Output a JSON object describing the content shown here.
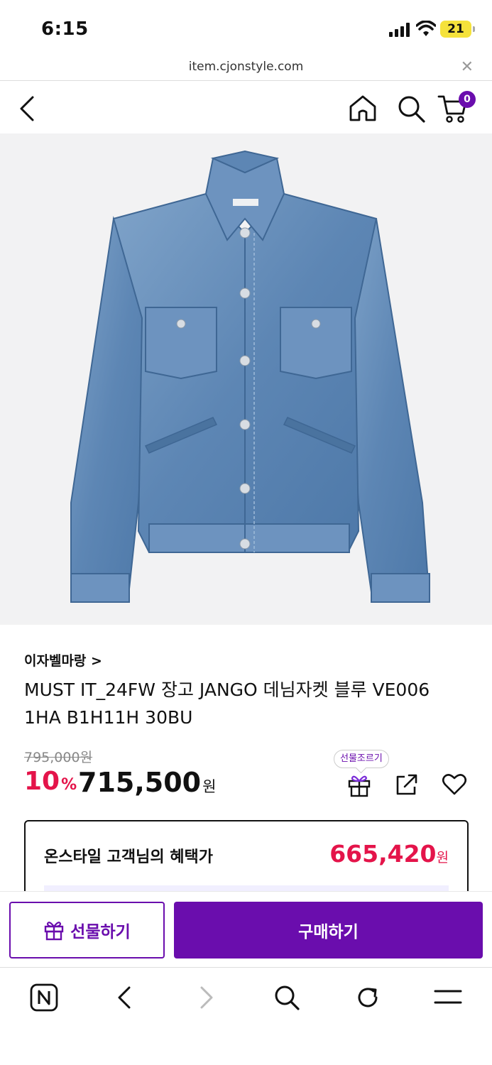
{
  "status_bar": {
    "time": "6:15",
    "battery": "21",
    "icons": [
      "signal-icon",
      "wifi-icon",
      "battery-icon"
    ]
  },
  "browser": {
    "url": "item.cjonstyle.com",
    "close_icon": "close-icon",
    "toolbar_icons": [
      "naver-icon",
      "back-icon",
      "forward-icon",
      "search-icon",
      "refresh-icon",
      "menu-icon"
    ]
  },
  "header": {
    "icons": [
      "back-icon",
      "home-icon",
      "search-icon",
      "cart-icon"
    ],
    "cart_count": "0"
  },
  "product": {
    "image": "denim-jacket-photo",
    "brand": "이자벨마랑 >",
    "title": "MUST IT_24FW 장고 JANGO 데님자켓 블루 VE006 1HA B1H11H 30BU",
    "original_price": "795,000원",
    "discount": "10",
    "discount_unit": "%",
    "price": "715,500",
    "price_unit": "원",
    "gift_tooltip": "선물조르기",
    "action_icons": [
      "gift-icon",
      "share-icon",
      "heart-icon"
    ]
  },
  "benefit": {
    "label": "온스타일 고객님의 혜택가",
    "price": "665,420",
    "unit": "원"
  },
  "buy_bar": {
    "gift_label": "선물하기",
    "buy_label": "구매하기"
  },
  "colors": {
    "brand_purple": "#6a0dad",
    "sale_red": "#e4144a",
    "battery_yellow": "#f5e23b"
  }
}
